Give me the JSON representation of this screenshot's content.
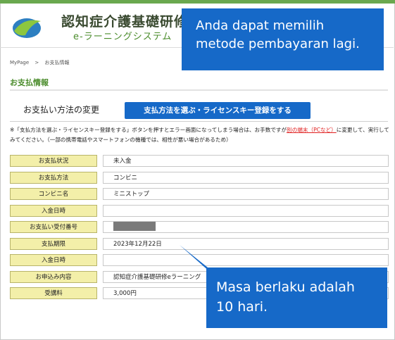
{
  "header": {
    "brand_title": "認知症介護基礎研修",
    "brand_sub_e": "e",
    "brand_sub_rest": "-ラーニングシステム"
  },
  "breadcrumb": {
    "home": "MyPage",
    "sep": ">",
    "current": "お支払情報"
  },
  "section_title": "お支払情報",
  "subsection": {
    "label": "お支払い方法の変更",
    "button_label": "支払方法を選ぶ・ライセンスキー登録をする"
  },
  "note": {
    "part1": "※「支払方法を選ぶ・ライセンスキー登録をする」ボタンを押すとエラー画面になってしまう場合は、お手数ですが",
    "link": "別の端末（PCなど）",
    "part2": "に変更して、実行してみてください。（一部の携帯電話やスマートフォンの機種では、相性が悪い場合があるため）"
  },
  "rows": [
    {
      "label": "お支払状況",
      "value": "未入金"
    },
    {
      "label": "お支払方法",
      "value": "コンビニ"
    },
    {
      "label": "コンビニ名",
      "value": "ミニストップ"
    },
    {
      "label": "入金日時",
      "value": ""
    },
    {
      "label": "お支払い受付番号",
      "value": ""
    },
    {
      "label": "支払期限",
      "value": "2023年12月22日"
    },
    {
      "label": "入金日時",
      "value": ""
    },
    {
      "label": "お申込み内容",
      "value": "認知症介護基礎研修eラーニング"
    },
    {
      "label": "受講料",
      "value": "3,000円"
    }
  ],
  "callouts": {
    "top_line1": "Anda dapat memilih",
    "top_line2": "metode pembayaran lagi.",
    "bottom_line1": "Masa berlaku adalah",
    "bottom_line2": "10 hari."
  },
  "colors": {
    "callout_blue": "#1669c8",
    "label_yellow": "#f3efa9",
    "brand_green": "#4b8c2c"
  }
}
